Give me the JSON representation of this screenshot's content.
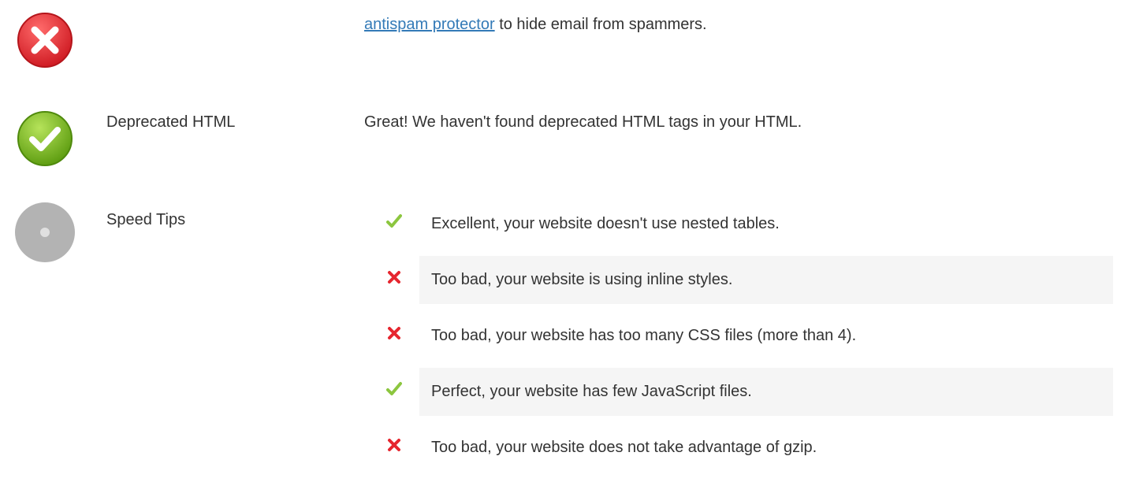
{
  "rows": {
    "email": {
      "status": "fail",
      "icon": "error-circle-icon",
      "description_link": "antispam protector",
      "description_rest": " to hide email from spammers."
    },
    "deprecated": {
      "status": "pass",
      "icon": "check-circle-icon",
      "name": "Deprecated HTML",
      "description": "Great! We haven't found deprecated HTML tags in your HTML."
    },
    "speed": {
      "status": "info",
      "icon": "neutral-circle-icon",
      "name": "Speed Tips",
      "tips": [
        {
          "status": "pass",
          "icon": "checkmark-icon",
          "text": "Excellent, your website doesn't use nested tables."
        },
        {
          "status": "fail",
          "icon": "cross-icon",
          "text": "Too bad, your website is using inline styles."
        },
        {
          "status": "fail",
          "icon": "cross-icon",
          "text": "Too bad, your website has too many CSS files (more than 4)."
        },
        {
          "status": "pass",
          "icon": "checkmark-icon",
          "text": "Perfect, your website has few JavaScript files."
        },
        {
          "status": "fail",
          "icon": "cross-icon",
          "text": "Too bad, your website does not take advantage of gzip."
        }
      ]
    }
  },
  "colors": {
    "fail_bg": "#f2dede",
    "pass_bg": "#dff0d8",
    "neutral_bg": "#f9f9f9",
    "link": "#337ab7",
    "pass_mark": "#8cc63f",
    "fail_mark": "#e6262f"
  }
}
